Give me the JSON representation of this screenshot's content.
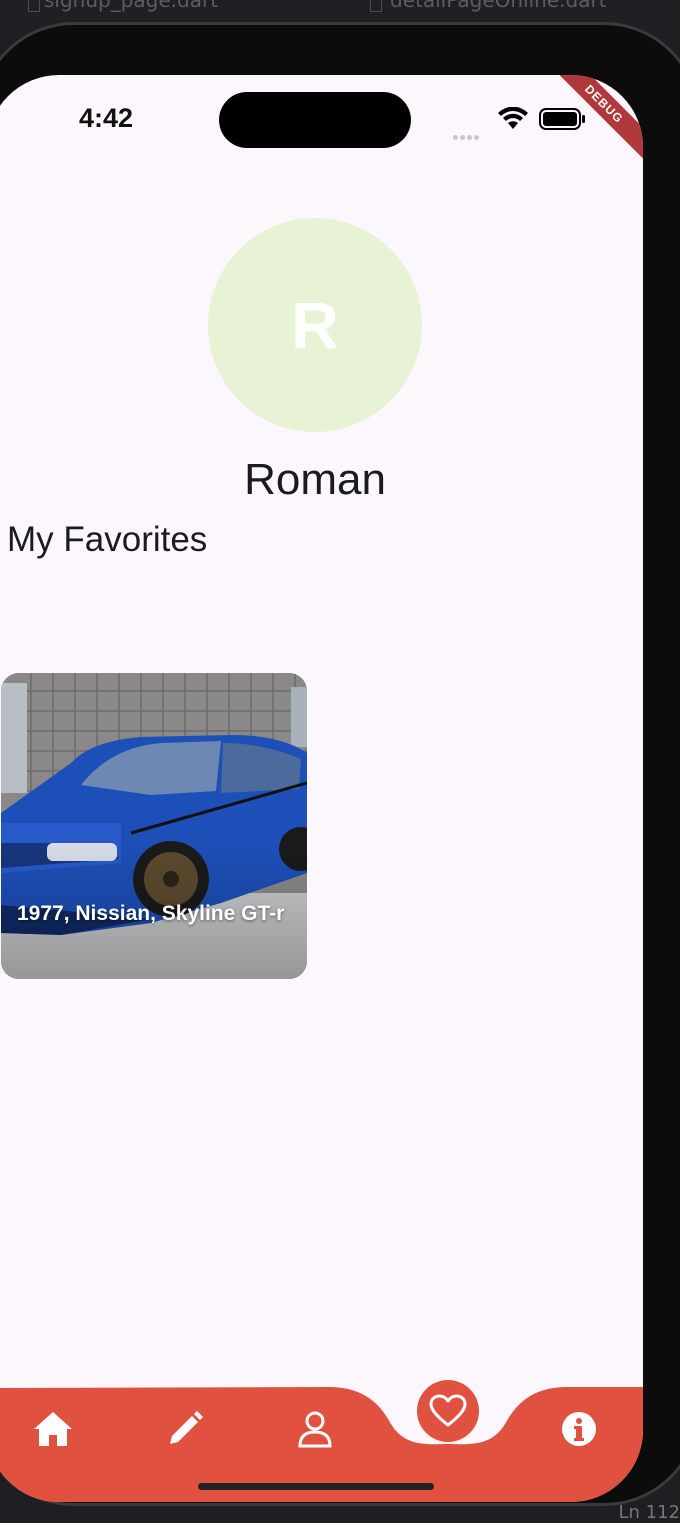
{
  "ide": {
    "left_tab": "signup_page.dart",
    "right_tab": "detailPageOnline.dart",
    "status_right": "Ln 112"
  },
  "status_bar": {
    "time": "4:42",
    "debug_banner": "DEBUG"
  },
  "profile": {
    "avatar_initial": "R",
    "avatar_color": "#e8f3d6",
    "name": "Roman"
  },
  "favorites": {
    "section_title": "My Favorites",
    "items": [
      {
        "title": "1977, Nissian, Skyline GT-r"
      }
    ]
  },
  "bottom_nav": {
    "accent_color": "#e0513f",
    "items": [
      {
        "icon": "home-icon",
        "active": false
      },
      {
        "icon": "pencil-icon",
        "active": false
      },
      {
        "icon": "person-icon",
        "active": false
      },
      {
        "icon": "heart-icon",
        "active": true
      },
      {
        "icon": "info-icon",
        "active": false
      }
    ]
  }
}
